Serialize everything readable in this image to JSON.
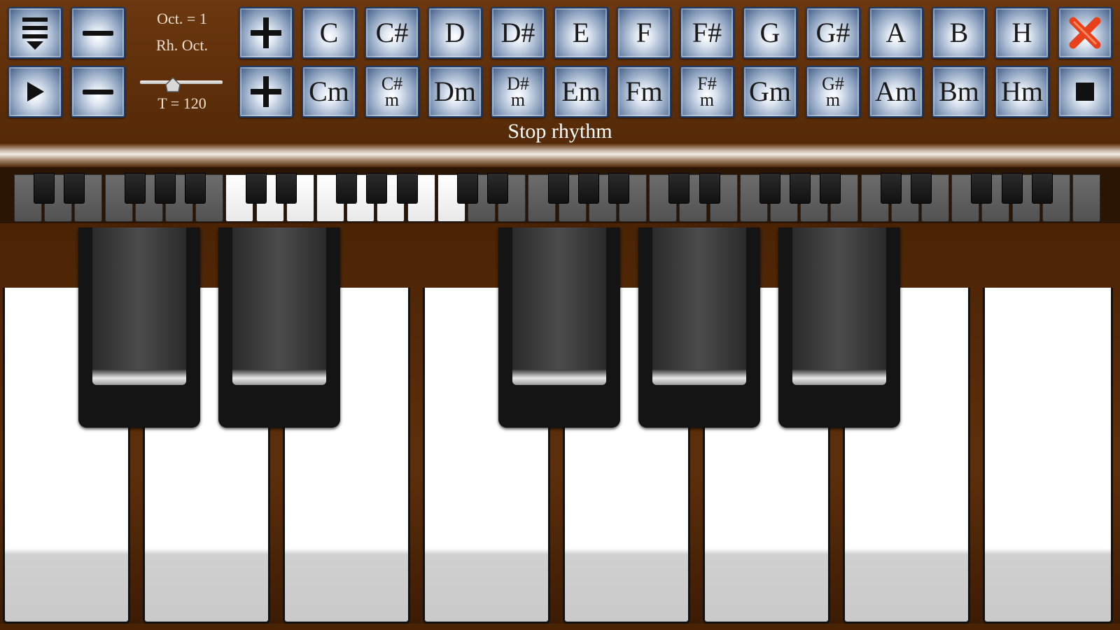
{
  "toolbar": {
    "menu_icon": "menu-down-icon",
    "play_icon": "play-icon",
    "minus_label": "—",
    "plus_label": "+",
    "octave_text": "Oct. = 1",
    "rh_octave_text": "Rh. Oct.",
    "tempo_text": "T = 120",
    "tempo_bpm": 120,
    "close_icon": "close-x-icon",
    "stop_icon": "stop-square-icon",
    "major_chords": [
      "C",
      "C#",
      "D",
      "D#",
      "E",
      "F",
      "F#",
      "G",
      "G#",
      "A",
      "B",
      "H"
    ],
    "minor_chords": [
      {
        "top": "Cm",
        "bottom": ""
      },
      {
        "top": "C#",
        "bottom": "m"
      },
      {
        "top": "Dm",
        "bottom": ""
      },
      {
        "top": "D#",
        "bottom": "m"
      },
      {
        "top": "Em",
        "bottom": ""
      },
      {
        "top": "Fm",
        "bottom": ""
      },
      {
        "top": "F#",
        "bottom": "m"
      },
      {
        "top": "Gm",
        "bottom": ""
      },
      {
        "top": "G#",
        "bottom": "m"
      },
      {
        "top": "Am",
        "bottom": ""
      },
      {
        "top": "Bm",
        "bottom": ""
      },
      {
        "top": "Hm",
        "bottom": ""
      }
    ]
  },
  "status": {
    "label": "Stop rhythm"
  },
  "colors": {
    "wood": "#5e2f0a",
    "button_border": "#1b3b6b",
    "close_accent": "#e8401a"
  }
}
